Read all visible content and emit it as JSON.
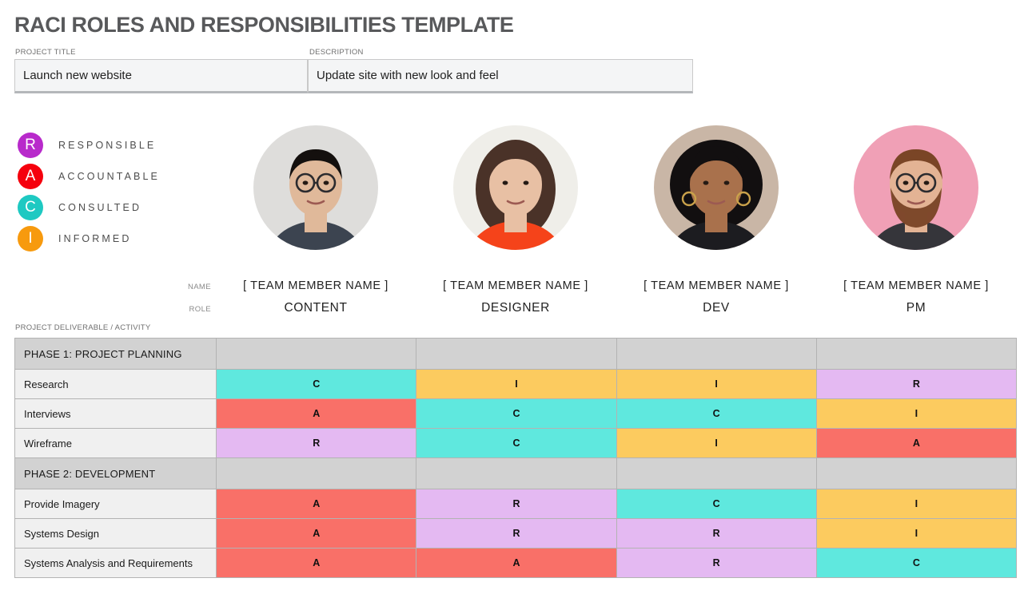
{
  "document": {
    "title": "RACI ROLES AND RESPONSIBILITIES TEMPLATE"
  },
  "header": {
    "project_title_label": "PROJECT TITLE",
    "project_title_value": "Launch new website",
    "description_label": "DESCRIPTION",
    "description_value": "Update site with new look and feel"
  },
  "legend": {
    "items": [
      {
        "key": "R",
        "label": "RESPONSIBLE",
        "color": "#b82acb"
      },
      {
        "key": "A",
        "label": "ACCOUNTABLE",
        "color": "#f5000d"
      },
      {
        "key": "C",
        "label": "CONSULTED",
        "color": "#1ec9c2"
      },
      {
        "key": "I",
        "label": "INFORMED",
        "color": "#f79a0e"
      }
    ]
  },
  "team": {
    "name_row_label": "NAME",
    "role_row_label": "ROLE",
    "members": [
      {
        "name": "[ TEAM MEMBER NAME ]",
        "role": "CONTENT",
        "avatar": "avatar-man-glasses-checkered-shirt"
      },
      {
        "name": "[ TEAM MEMBER NAME ]",
        "role": "DESIGNER",
        "avatar": "avatar-woman-brown-hair-orange-sweater"
      },
      {
        "name": "[ TEAM MEMBER NAME ]",
        "role": "DEV",
        "avatar": "avatar-woman-curly-hair-hoop-earrings"
      },
      {
        "name": "[ TEAM MEMBER NAME ]",
        "role": "PM",
        "avatar": "avatar-bearded-man-pink-background"
      }
    ]
  },
  "matrix": {
    "caption": "PROJECT DELIVERABLE / ACTIVITY",
    "cell_colors": {
      "R": "#e4b9f2",
      "A": "#f97068",
      "C": "#5fe8de",
      "I": "#fccb5f",
      "empty": "#d2d2d2"
    },
    "rows": [
      {
        "type": "phase",
        "activity": "PHASE 1: PROJECT PLANNING",
        "values": [
          "",
          "",
          "",
          ""
        ]
      },
      {
        "type": "task",
        "activity": "Research",
        "values": [
          "C",
          "I",
          "I",
          "R"
        ]
      },
      {
        "type": "task",
        "activity": "Interviews",
        "values": [
          "A",
          "C",
          "C",
          "I"
        ]
      },
      {
        "type": "task",
        "activity": "Wireframe",
        "values": [
          "R",
          "C",
          "I",
          "A"
        ]
      },
      {
        "type": "phase",
        "activity": "PHASE 2: DEVELOPMENT",
        "values": [
          "",
          "",
          "",
          ""
        ]
      },
      {
        "type": "task",
        "activity": "Provide Imagery",
        "values": [
          "A",
          "R",
          "C",
          "I"
        ]
      },
      {
        "type": "task",
        "activity": "Systems Design",
        "values": [
          "A",
          "R",
          "R",
          "I"
        ]
      },
      {
        "type": "task",
        "activity": "Systems Analysis and Requirements",
        "values": [
          "A",
          "A",
          "R",
          "C"
        ]
      }
    ]
  }
}
